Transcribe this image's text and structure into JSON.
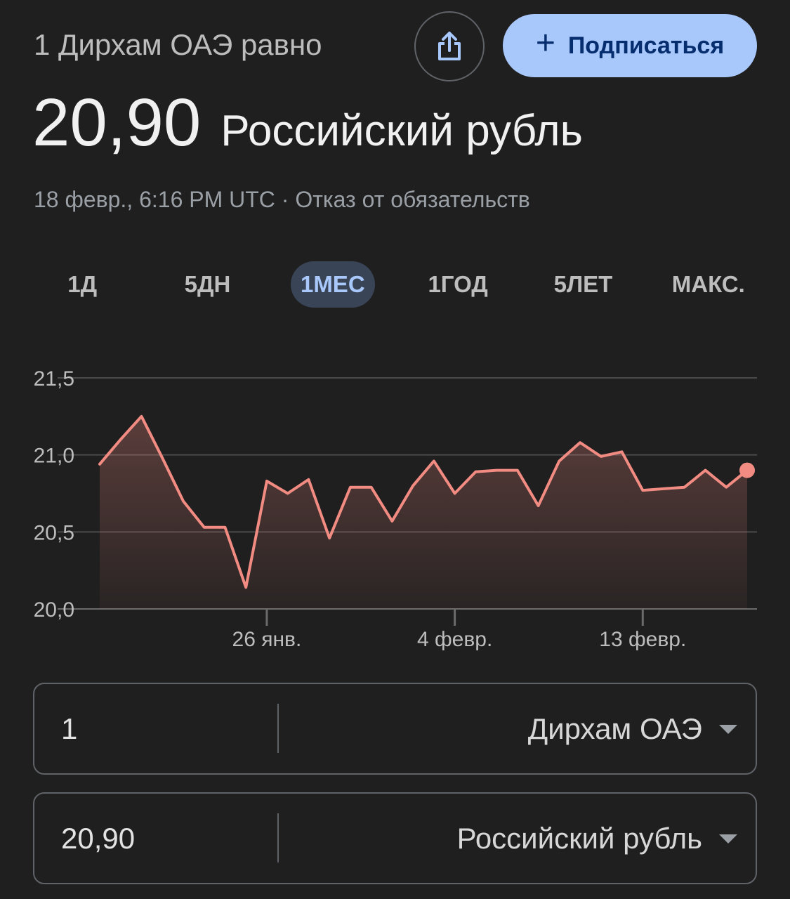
{
  "header": {
    "subtitle": "1 Дирхам ОАЭ равно",
    "rate_value": "20,90",
    "rate_currency": "Российский рубль",
    "meta": "18 февр., 6:16 PM UTC · Отказ от обязательств",
    "share_icon": "share-icon",
    "subscribe_label": "Подписаться",
    "subscribe_icon": "+"
  },
  "tabs": [
    {
      "label": "1Д",
      "active": false
    },
    {
      "label": "5ДН",
      "active": false
    },
    {
      "label": "1МЕС",
      "active": true
    },
    {
      "label": "1ГОД",
      "active": false
    },
    {
      "label": "5ЛЕТ",
      "active": false
    },
    {
      "label": "МАКС.",
      "active": false
    }
  ],
  "chart_data": {
    "type": "area",
    "title": "",
    "xlabel": "",
    "ylabel": "",
    "y_ticks": [
      "21,5",
      "21,0",
      "20,5",
      "20,0"
    ],
    "y_tick_values": [
      21.5,
      21.0,
      20.5,
      20.0
    ],
    "ylim": [
      20.0,
      21.5
    ],
    "x_ticks": [
      {
        "label": "26 янв.",
        "index": 8
      },
      {
        "label": "4 февр.",
        "index": 17
      },
      {
        "label": "13 февр.",
        "index": 26
      }
    ],
    "values": [
      20.94,
      21.1,
      21.25,
      20.98,
      20.7,
      20.53,
      20.53,
      20.14,
      20.83,
      20.75,
      20.84,
      20.46,
      20.79,
      20.79,
      20.57,
      20.8,
      20.96,
      20.75,
      20.89,
      20.9,
      20.9,
      20.67,
      20.96,
      21.08,
      20.99,
      21.02,
      20.77,
      20.78,
      20.79,
      20.9,
      20.79,
      20.9
    ],
    "grid": true,
    "line_color": "#f28b82",
    "fill_color": "#f28b82"
  },
  "converter": {
    "from_amount": "1",
    "from_currency": "Дирхам ОАЭ",
    "to_amount": "20,90",
    "to_currency": "Российский рубль"
  }
}
